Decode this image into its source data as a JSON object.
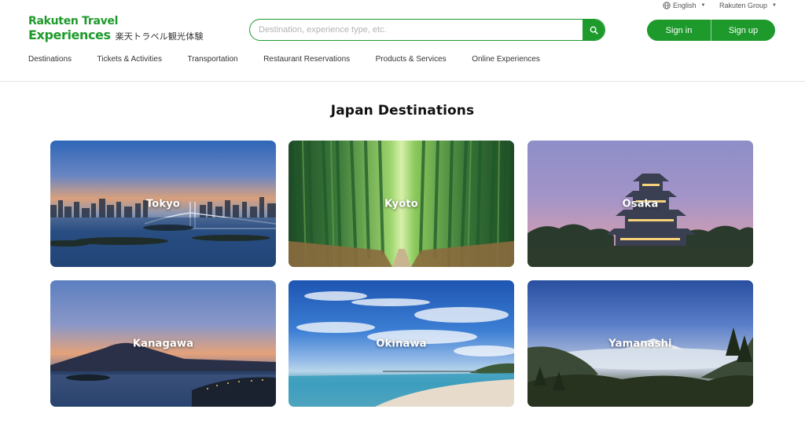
{
  "brand": {
    "name_line1": "Rakuten Travel",
    "name_line2": "Experiences",
    "name_jp": "楽天トラベル観光体験"
  },
  "search": {
    "placeholder": "Destination, experience type, etc."
  },
  "utility": {
    "language": "English",
    "group": "Rakuten Group"
  },
  "auth": {
    "sign_in": "Sign in",
    "sign_up": "Sign up"
  },
  "nav": {
    "items": [
      "Destinations",
      "Tickets & Activities",
      "Transportation",
      "Restaurant Reservations",
      "Products & Services",
      "Online Experiences"
    ]
  },
  "main": {
    "title": "Japan Destinations",
    "destinations": [
      {
        "label": "Tokyo"
      },
      {
        "label": "Kyoto"
      },
      {
        "label": "Osaka"
      },
      {
        "label": "Kanagawa"
      },
      {
        "label": "Okinawa"
      },
      {
        "label": "Yamanashi"
      }
    ]
  },
  "colors": {
    "brand_green": "#1d9a2b"
  }
}
